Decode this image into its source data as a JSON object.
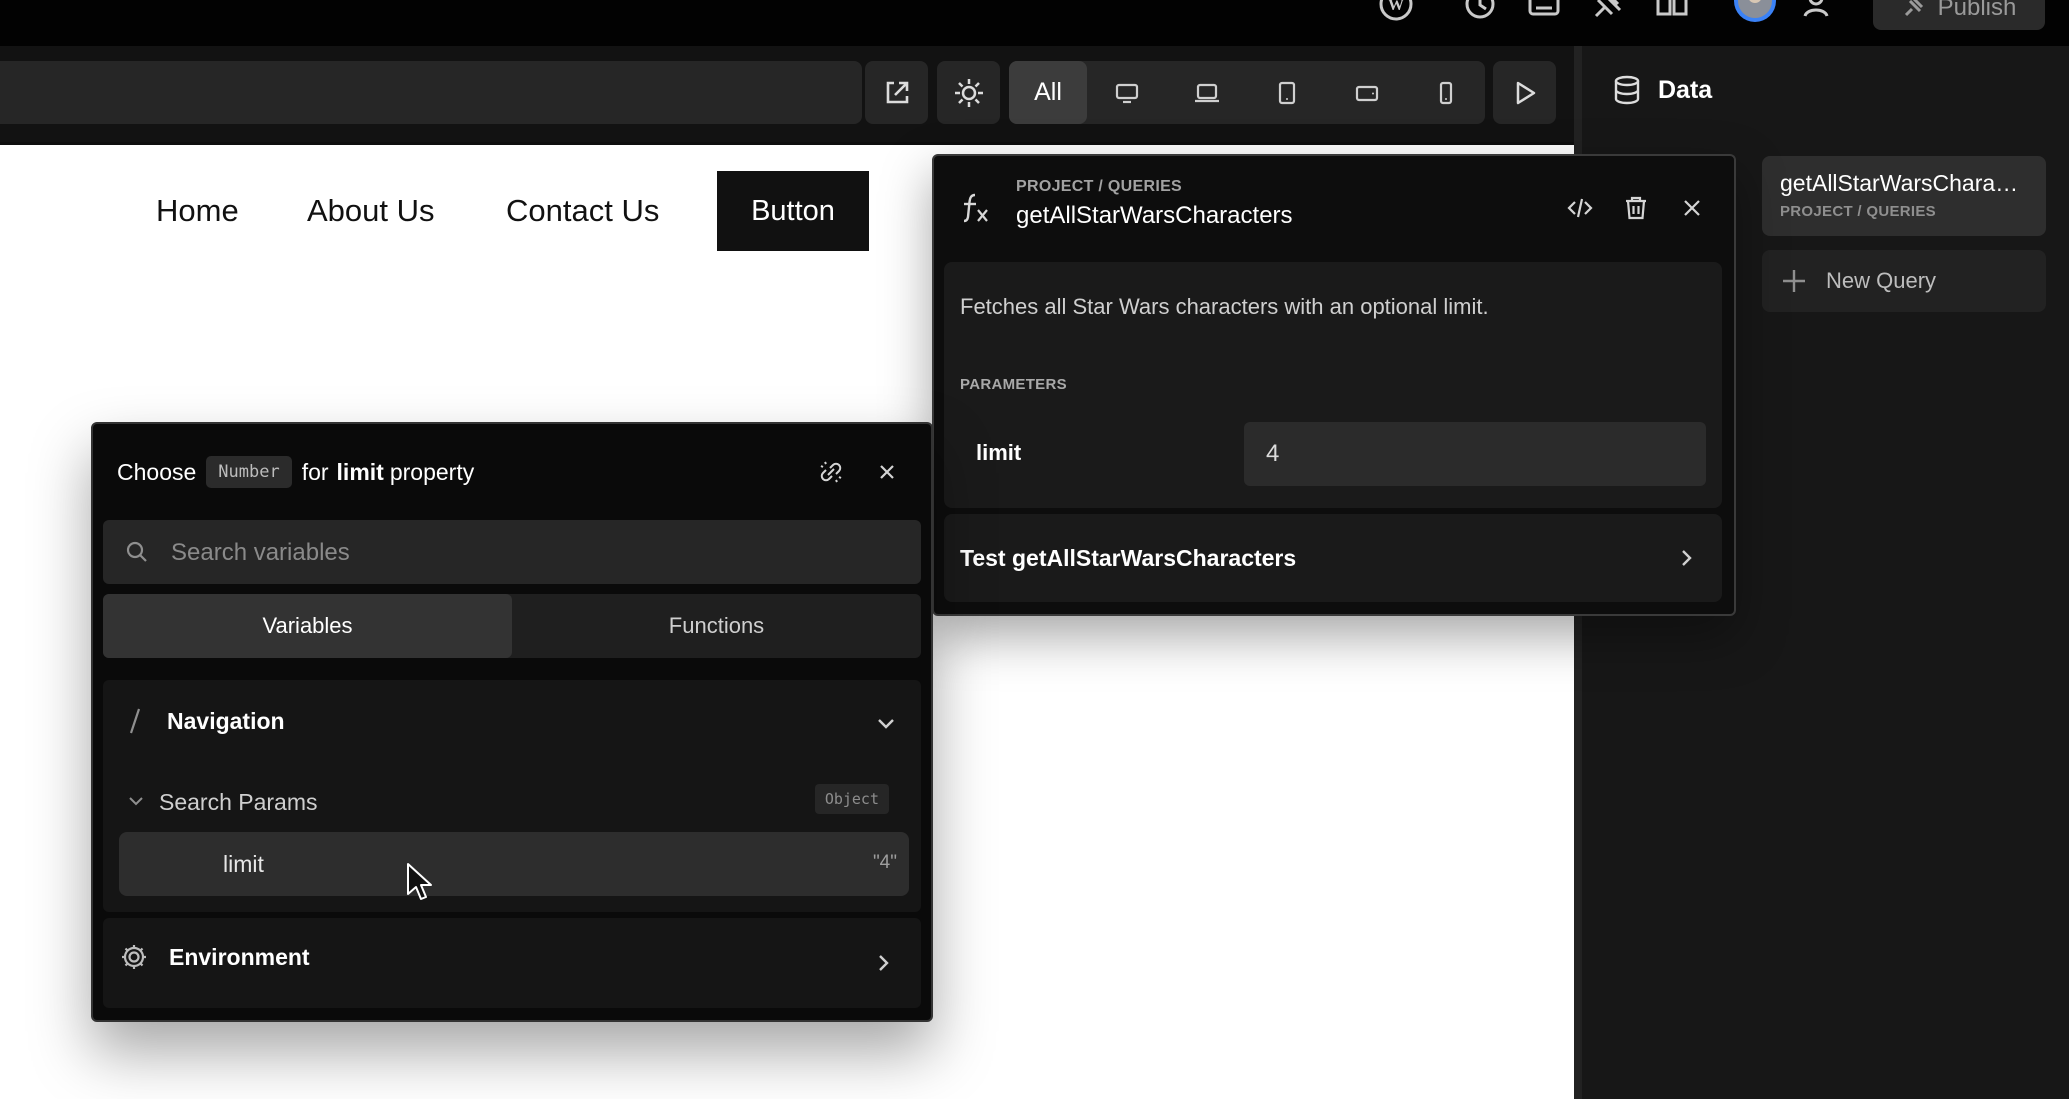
{
  "topbar": {
    "icons": [
      "wordpress-icon",
      "history-icon",
      "keyboard-icon",
      "pin-icon",
      "book-icon",
      "avatar",
      "users-icon"
    ],
    "publish_label": "Publish"
  },
  "toolbar": {
    "breakpoints": [
      {
        "name": "all",
        "label": "All",
        "active": true
      },
      {
        "name": "desktop-icon",
        "label": ""
      },
      {
        "name": "laptop-icon",
        "label": ""
      },
      {
        "name": "tablet-icon",
        "label": ""
      },
      {
        "name": "tablet-landscape-icon",
        "label": ""
      },
      {
        "name": "mobile-icon",
        "label": ""
      }
    ]
  },
  "canvas": {
    "nav_links": [
      "Home",
      "About Us",
      "Contact Us"
    ],
    "nav_button": "Button"
  },
  "right_panel": {
    "title": "Data",
    "query": {
      "name": "getAllStarWarsCharacters",
      "path": "PROJECT / QUERIES"
    },
    "new_query_label": "New Query"
  },
  "query_popover": {
    "path": "PROJECT / QUERIES",
    "name": "getAllStarWarsCharacters",
    "description": "Fetches all Star Wars characters with an optional limit.",
    "parameters_label": "PARAMETERS",
    "param_name": "limit",
    "param_value": "4",
    "test_label": "Test getAllStarWarsCharacters"
  },
  "variable_chooser": {
    "choose": "Choose",
    "type_chip": "Number",
    "for": "for",
    "property_name": "limit",
    "property_word": "property",
    "search_placeholder": "Search variables",
    "tabs": [
      {
        "label": "Variables",
        "active": true
      },
      {
        "label": "Functions",
        "active": false
      }
    ],
    "navigation": {
      "title": "Navigation",
      "search_params": {
        "label": "Search Params",
        "type": "Object"
      },
      "item": {
        "label": "limit",
        "value": "\"4\""
      }
    },
    "environment": {
      "title": "Environment"
    }
  }
}
